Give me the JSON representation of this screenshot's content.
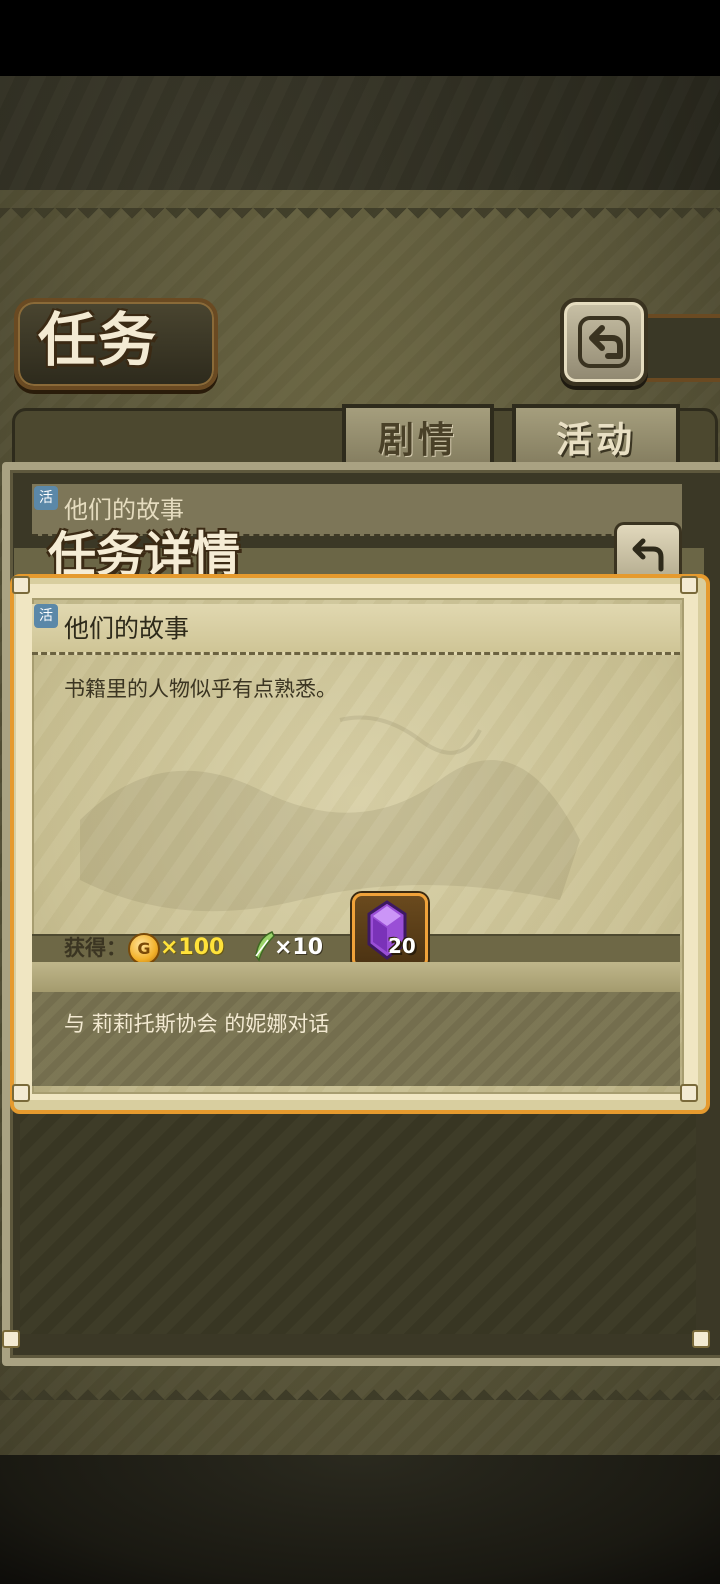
{
  "screen": {
    "title": "任务",
    "tabs": [
      {
        "label": "剧情",
        "active": true
      },
      {
        "label": "活动",
        "active": false
      }
    ],
    "back_icon": "return-arrow-icon"
  },
  "quest_list": {
    "items": [
      {
        "badge": "活",
        "title": "他们的故事"
      }
    ]
  },
  "detail": {
    "header": "任务详情",
    "badge": "活",
    "name": "他们的故事",
    "description": "书籍里的人物似乎有点熟悉。",
    "rewards_label": "获得：",
    "rewards": [
      {
        "icon": "gold-coin-icon",
        "symbol": "G",
        "count": "×100",
        "color": "#ffe23a"
      },
      {
        "icon": "feather-icon",
        "count": "×10",
        "color": "#ffffff"
      },
      {
        "icon": "purple-gem-icon",
        "count": "20"
      }
    ],
    "objective": "与 莉莉托斯协会 的妮娜对话"
  },
  "colors": {
    "accent_orange": "#e59a2e",
    "paper": "#d9d1a8",
    "dark_olive": "#4c482f"
  }
}
